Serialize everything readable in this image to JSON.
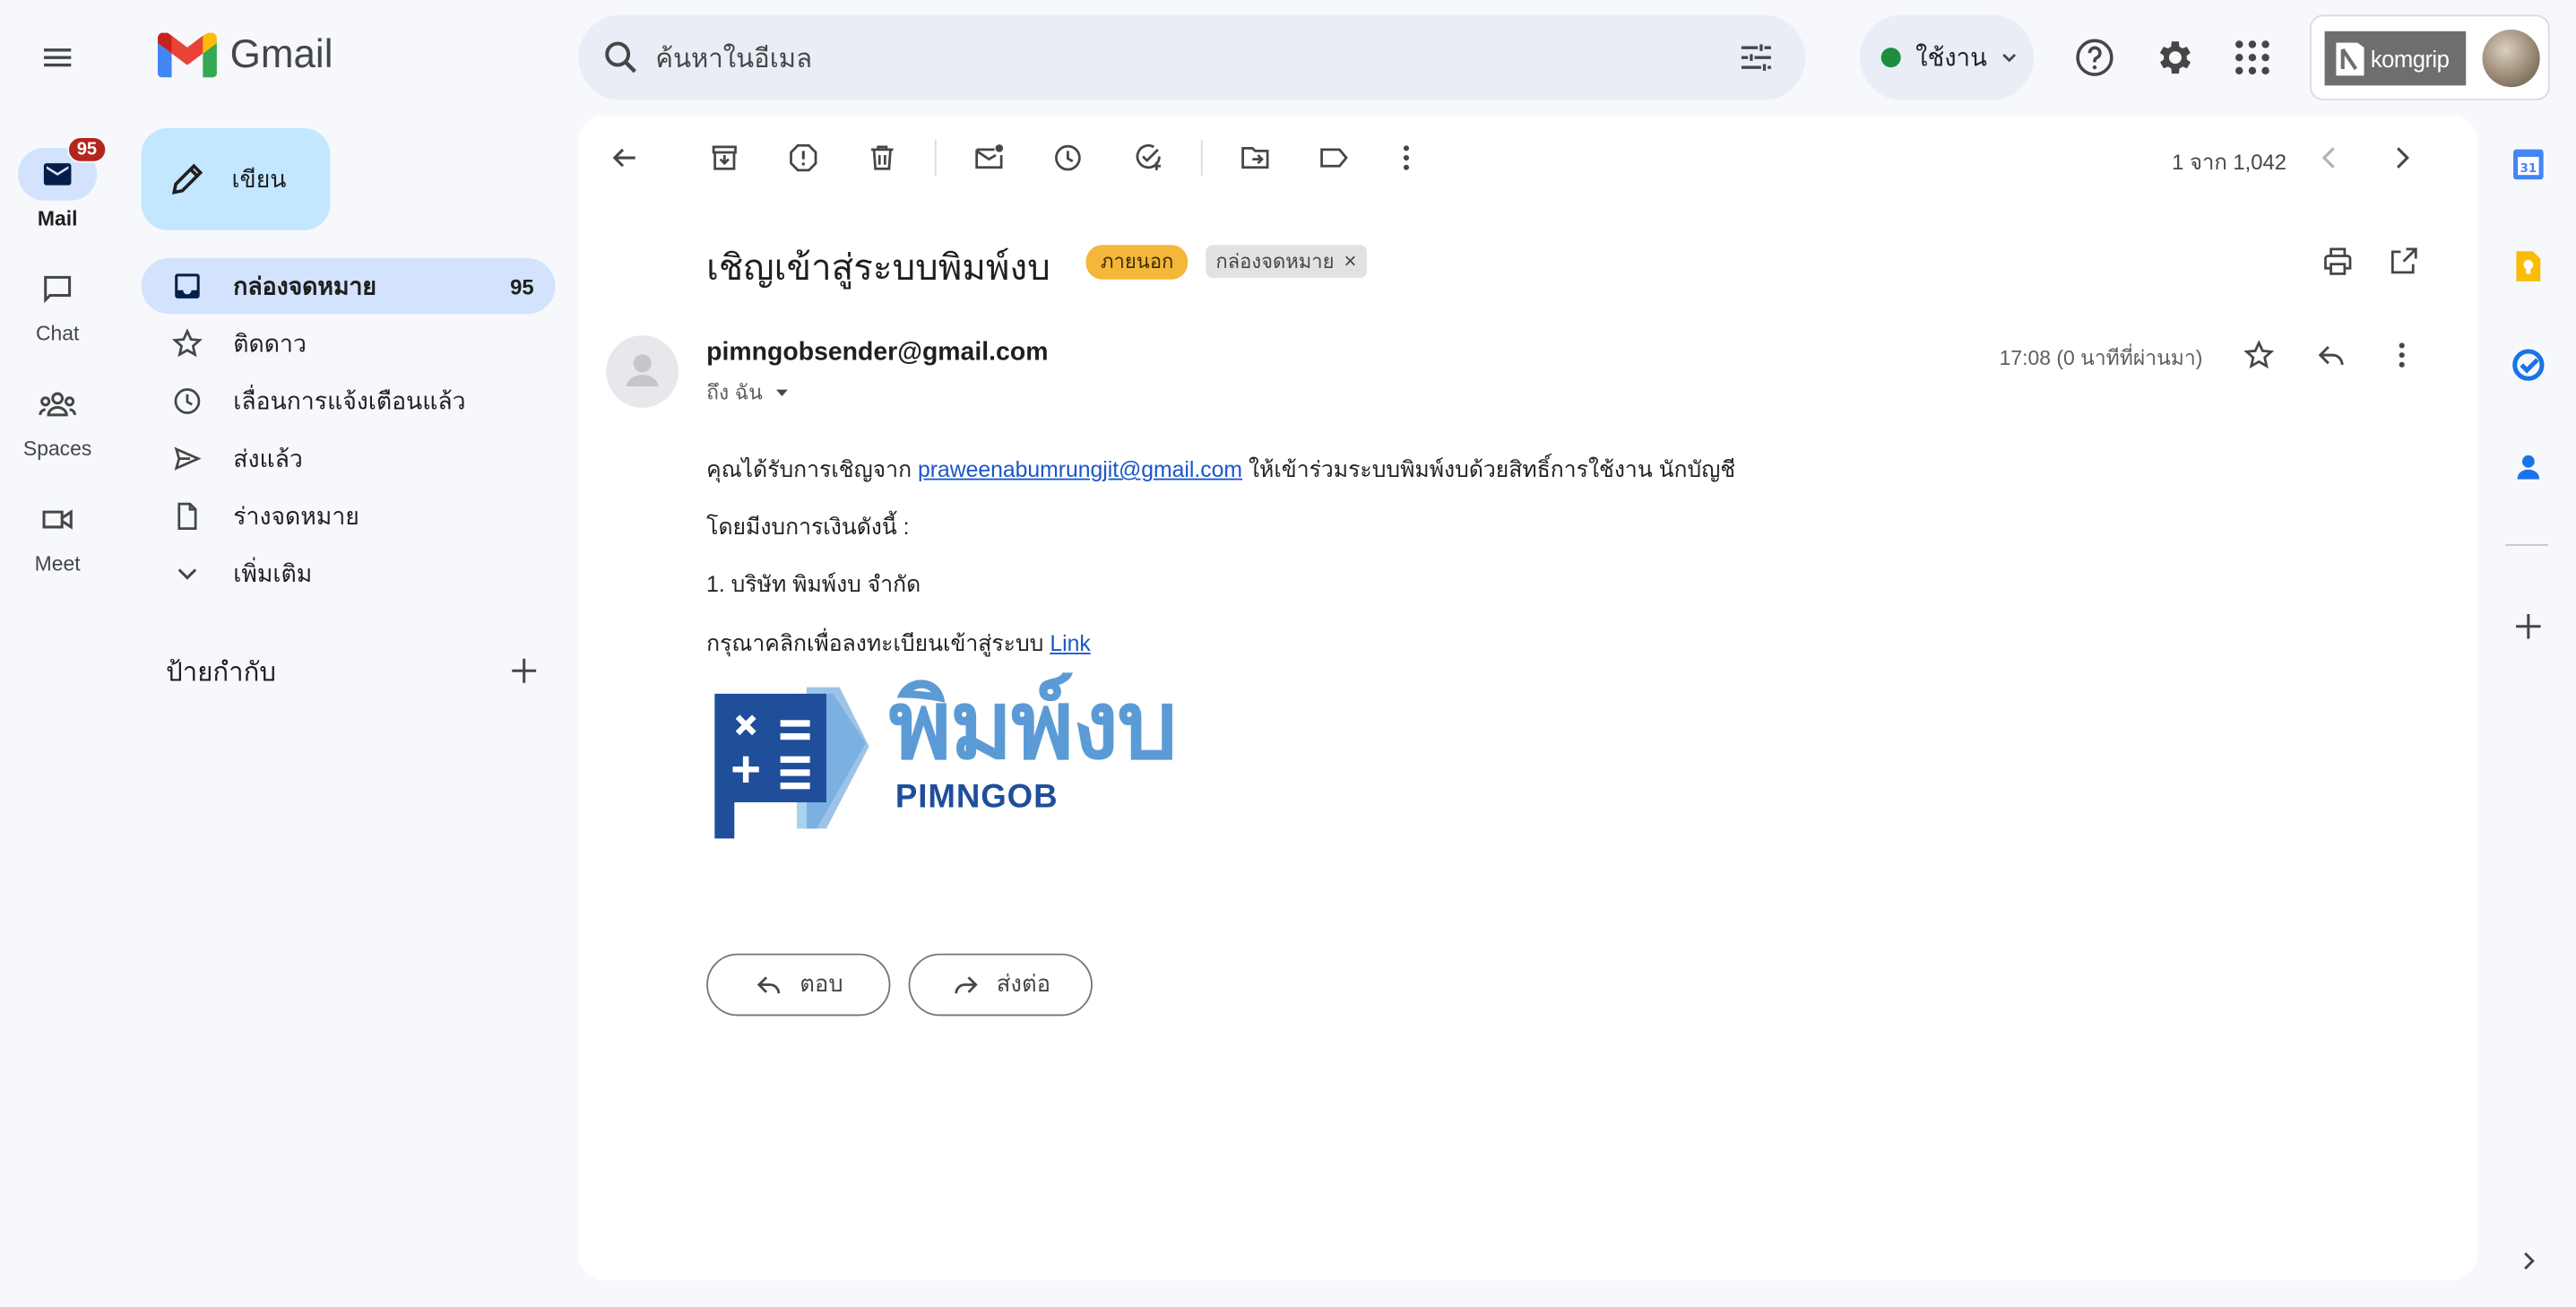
{
  "app": {
    "name": "Gmail",
    "search_placeholder": "ค้นหาในอีเมล",
    "status_label": "ใช้งาน",
    "account_brand": "komgrip"
  },
  "rail": [
    {
      "label": "Mail",
      "badge": "95",
      "icon": "mail-icon"
    },
    {
      "label": "Chat",
      "icon": "chat-icon"
    },
    {
      "label": "Spaces",
      "icon": "spaces-icon"
    },
    {
      "label": "Meet",
      "icon": "meet-icon"
    }
  ],
  "sidebar": {
    "compose_label": "เขียน",
    "items": [
      {
        "label": "กล่องจดหมาย",
        "count": "95",
        "icon": "inbox-icon"
      },
      {
        "label": "ติดดาว",
        "icon": "star-icon"
      },
      {
        "label": "เลื่อนการแจ้งเตือนแล้ว",
        "icon": "clock-icon"
      },
      {
        "label": "ส่งแล้ว",
        "icon": "send-icon"
      },
      {
        "label": "ร่างจดหมาย",
        "icon": "draft-icon"
      },
      {
        "label": "เพิ่มเติม",
        "icon": "chevron-down-icon"
      }
    ],
    "labels_heading": "ป้ายกำกับ"
  },
  "toolbar": {
    "pagination": "1 จาก 1,042"
  },
  "email": {
    "subject": "เชิญเข้าสู่ระบบพิมพ์งบ",
    "badge_external": "ภายนอก",
    "badge_inbox": "กล่องจดหมาย",
    "sender": "pimngobsender@gmail.com",
    "to": "ถึง ฉัน",
    "time": "17:08 (0 นาทีที่ผ่านมา)",
    "body": {
      "line1_prefix": "คุณได้รับการเชิญจาก",
      "line1_link": "praweenabumrungjit@gmail.com",
      "line1_suffix": "ให้เข้าร่วมระบบพิมพ์งบด้วยสิทธิ์การใช้งาน นักบัญชี",
      "line2": "โดยมีงบการเงินดังนี้ :",
      "line3": "1. บริษัท พิมพ์งบ จำกัด",
      "line4_prefix": "กรุณาคลิกเพื่อลงทะเบียนเข้าสู่ระบบ",
      "line4_link": "Link"
    },
    "logo": {
      "thai": "พิมพ์งบ",
      "latin": "PIMNGOB"
    },
    "reply_label": "ตอบ",
    "forward_label": "ส่งต่อ"
  },
  "colors": {
    "accent": "#0b57d0",
    "sidebar_active": "#d3e3fd",
    "badge_external": "#f4b73a",
    "badge_red": "#b3261e",
    "logo_dark": "#1f4e9a",
    "logo_light": "#5b9bd5"
  }
}
